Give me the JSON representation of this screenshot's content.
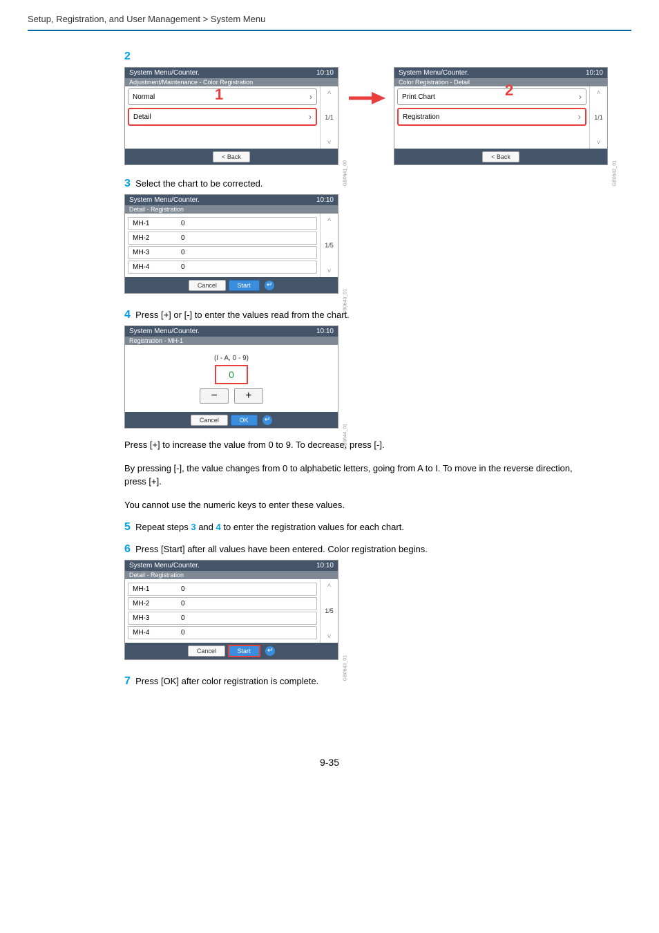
{
  "header": {
    "breadcrumb": "Setup, Registration, and User Management > System Menu"
  },
  "steps": {
    "s2": {
      "num": "2"
    },
    "s3": {
      "num": "3",
      "text": "Select the chart to be corrected."
    },
    "s4": {
      "num": "4",
      "text": "Press [+] or [-] to enter the values read from the chart."
    },
    "s5": {
      "num": "5",
      "text_a": "Repeat steps ",
      "ref1": "3",
      "text_b": " and ",
      "ref2": "4",
      "text_c": " to enter the registration values for each chart."
    },
    "s6": {
      "num": "6",
      "text": "Press [Start] after all values have been entered. Color registration begins."
    },
    "s7": {
      "num": "7",
      "text": "Press [OK] after color registration is complete."
    }
  },
  "panelA": {
    "title": "System Menu/Counter.",
    "time": "10:10",
    "sub": "Adjustment/Maintenance - Color Registration",
    "items": [
      {
        "label": "Normal",
        "highlight": false
      },
      {
        "label": "Detail",
        "highlight": true
      }
    ],
    "page": "1/1",
    "back": "< Back",
    "gb": "GB0641_00",
    "callout": "1"
  },
  "panelB": {
    "title": "System Menu/Counter.",
    "time": "10:10",
    "sub": "Color Registration - Detail",
    "items": [
      {
        "label": "Print Chart",
        "highlight": false
      },
      {
        "label": "Registration",
        "highlight": true
      }
    ],
    "page": "1/1",
    "back": "< Back",
    "gb": "GB0642_01",
    "callout": "2"
  },
  "panelC": {
    "title": "System Menu/Counter.",
    "time": "10:10",
    "sub": "Detail - Registration",
    "rows": [
      {
        "label": "MH-1",
        "val": "0"
      },
      {
        "label": "MH-2",
        "val": "0"
      },
      {
        "label": "MH-3",
        "val": "0"
      },
      {
        "label": "MH-4",
        "val": "0"
      }
    ],
    "page": "1/5",
    "cancel": "Cancel",
    "start": "Start",
    "gb": "GB0643_01"
  },
  "panelD": {
    "title": "System Menu/Counter.",
    "time": "10:10",
    "sub": "Registration - MH-1",
    "range": "(I - A, 0 - 9)",
    "value": "0",
    "minus": "−",
    "plus": "+",
    "cancel": "Cancel",
    "ok": "OK",
    "gb": "GB0644_01"
  },
  "panelE": {
    "title": "System Menu/Counter.",
    "time": "10:10",
    "sub": "Detail - Registration",
    "rows": [
      {
        "label": "MH-1",
        "val": "0"
      },
      {
        "label": "MH-2",
        "val": "0"
      },
      {
        "label": "MH-3",
        "val": "0"
      },
      {
        "label": "MH-4",
        "val": "0"
      }
    ],
    "page": "1/5",
    "cancel": "Cancel",
    "start": "Start",
    "gb": "GB0643_01"
  },
  "body_text": {
    "p1": "Press [+] to increase the value from 0 to 9. To decrease, press [-].",
    "p2": "By pressing [-], the value changes from 0 to alphabetic letters, going from A to I. To move in the reverse direction, press [+].",
    "p3": "You cannot use the numeric keys to enter these values."
  },
  "page_num": "9-35"
}
